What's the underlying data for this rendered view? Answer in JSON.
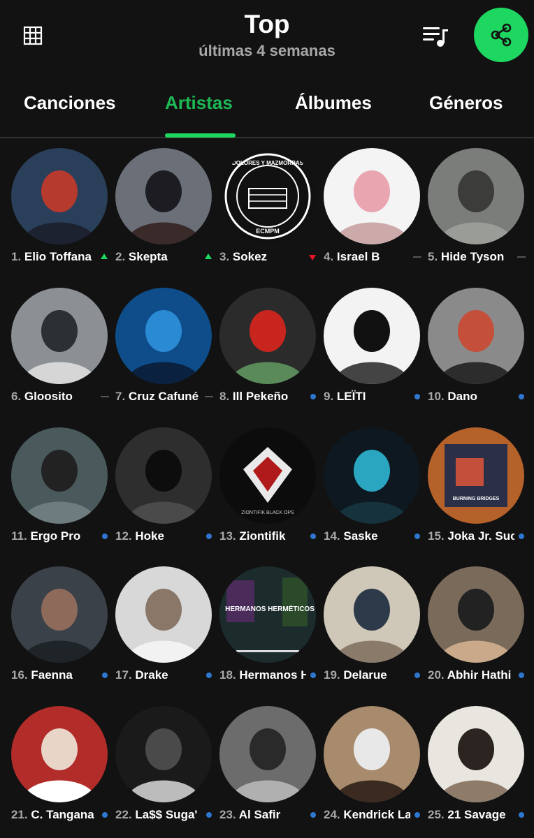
{
  "header": {
    "title": "Top",
    "subtitle": "últimas 4 semanas",
    "grid_icon": "grid-icon",
    "queue_icon": "queue-music-icon",
    "share_icon": "share-icon",
    "accent": "#1ed760"
  },
  "tabs": [
    {
      "label": "Canciones",
      "active": false
    },
    {
      "label": "Artistas",
      "active": true
    },
    {
      "label": "Álbumes",
      "active": false
    },
    {
      "label": "Géneros",
      "active": false
    }
  ],
  "artists": [
    {
      "rank": "1.",
      "name": "Elio Toffana",
      "trend": "up"
    },
    {
      "rank": "2.",
      "name": "Skepta",
      "trend": "up"
    },
    {
      "rank": "3.",
      "name": "Sokez",
      "trend": "down"
    },
    {
      "rank": "4.",
      "name": "Israel B",
      "trend": "same"
    },
    {
      "rank": "5.",
      "name": "Hide Tyson",
      "trend": "same"
    },
    {
      "rank": "6.",
      "name": "Gloosito",
      "trend": "same"
    },
    {
      "rank": "7.",
      "name": "Cruz Cafuné",
      "trend": "same"
    },
    {
      "rank": "8.",
      "name": "Ill Pekeño",
      "trend": "new"
    },
    {
      "rank": "9.",
      "name": "LEÏTI",
      "trend": "new"
    },
    {
      "rank": "10.",
      "name": "Dano",
      "trend": "new"
    },
    {
      "rank": "11.",
      "name": "Ergo Pro",
      "trend": "new"
    },
    {
      "rank": "12.",
      "name": "Hoke",
      "trend": "new"
    },
    {
      "rank": "13.",
      "name": "Ziontifik",
      "trend": "new"
    },
    {
      "rank": "14.",
      "name": "Saske",
      "trend": "new"
    },
    {
      "rank": "15.",
      "name": "Joka Jr. Sucio",
      "trend": "new"
    },
    {
      "rank": "16.",
      "name": "Faenna",
      "trend": "new"
    },
    {
      "rank": "17.",
      "name": "Drake",
      "trend": "new"
    },
    {
      "rank": "18.",
      "name": "Hermanos Herméticos",
      "trend": "new"
    },
    {
      "rank": "19.",
      "name": "Delarue",
      "trend": "new"
    },
    {
      "rank": "20.",
      "name": "Abhir Hathi",
      "trend": "new"
    },
    {
      "rank": "21.",
      "name": "C. Tangana",
      "trend": "new"
    },
    {
      "rank": "22.",
      "name": "La$$ Suga'",
      "trend": "new"
    },
    {
      "rank": "23.",
      "name": "Al Safir",
      "trend": "new"
    },
    {
      "rank": "24.",
      "name": "Kendrick Lamar",
      "trend": "new"
    },
    {
      "rank": "25.",
      "name": "21 Savage",
      "trend": "new"
    }
  ],
  "image_text": {
    "sokez_logo_top": "DOLORES Y MAZMORRAS",
    "sokez_logo_bottom": "ECMPM",
    "ziontifik_caption": "ZIONTIFIK BLACK OPS",
    "joka_cover_title": "BURNING BRIDGES",
    "hermanos_logo": "HERMANOS HERMÉTICOS"
  }
}
